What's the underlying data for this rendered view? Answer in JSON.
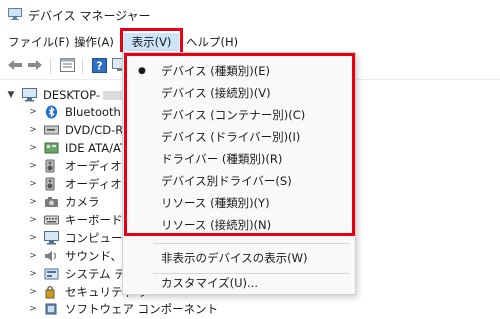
{
  "window": {
    "title": "デバイス マネージャー"
  },
  "menubar": {
    "items": [
      {
        "label": "ファイル(F)"
      },
      {
        "label": "操作(A)"
      },
      {
        "label": "表示(V)"
      },
      {
        "label": "ヘルプ(H)"
      }
    ]
  },
  "tree": {
    "root": "DESKTOP-",
    "items": [
      {
        "label": "Bluetooth",
        "icon": "bluetooth-icon"
      },
      {
        "label": "DVD/CD-RO",
        "icon": "dvd-drive-icon"
      },
      {
        "label": "IDE ATA/AT",
        "icon": "ide-controller-icon"
      },
      {
        "label": "オーディオの入",
        "icon": "audio-io-icon"
      },
      {
        "label": "オーディオ処理",
        "icon": "audio-processing-icon"
      },
      {
        "label": "カメラ",
        "icon": "camera-icon"
      },
      {
        "label": "キーボード",
        "icon": "keyboard-icon"
      },
      {
        "label": "コンピューター",
        "icon": "computer-icon"
      },
      {
        "label": "サウンド、ビデ",
        "icon": "sound-video-icon"
      },
      {
        "label": "システム デバ",
        "icon": "system-device-icon"
      },
      {
        "label": "セキュリティ ラ",
        "icon": "security-icon"
      },
      {
        "label": "ソフトウェア コンポーネント",
        "icon": "software-component-icon"
      }
    ]
  },
  "view_menu": {
    "selected_index": 0,
    "items": [
      {
        "label": "デバイス (種類別)(E)"
      },
      {
        "label": "デバイス (接続別)(V)"
      },
      {
        "label": "デバイス (コンテナー別)(C)"
      },
      {
        "label": "デバイス (ドライバー別)(I)"
      },
      {
        "label": "ドライバー (種類別)(R)"
      },
      {
        "label": "デバイス別ドライバー(S)"
      },
      {
        "label": "リソース (種類別)(Y)"
      },
      {
        "label": "リソース (接続別)(N)"
      }
    ],
    "extra_items": [
      {
        "label": "非表示のデバイスの表示(W)"
      },
      {
        "label": "カスタマイズ(U)..."
      }
    ]
  },
  "colors": {
    "highlight_frame": "#e60012",
    "menu_active_bg": "#cce4f7"
  }
}
